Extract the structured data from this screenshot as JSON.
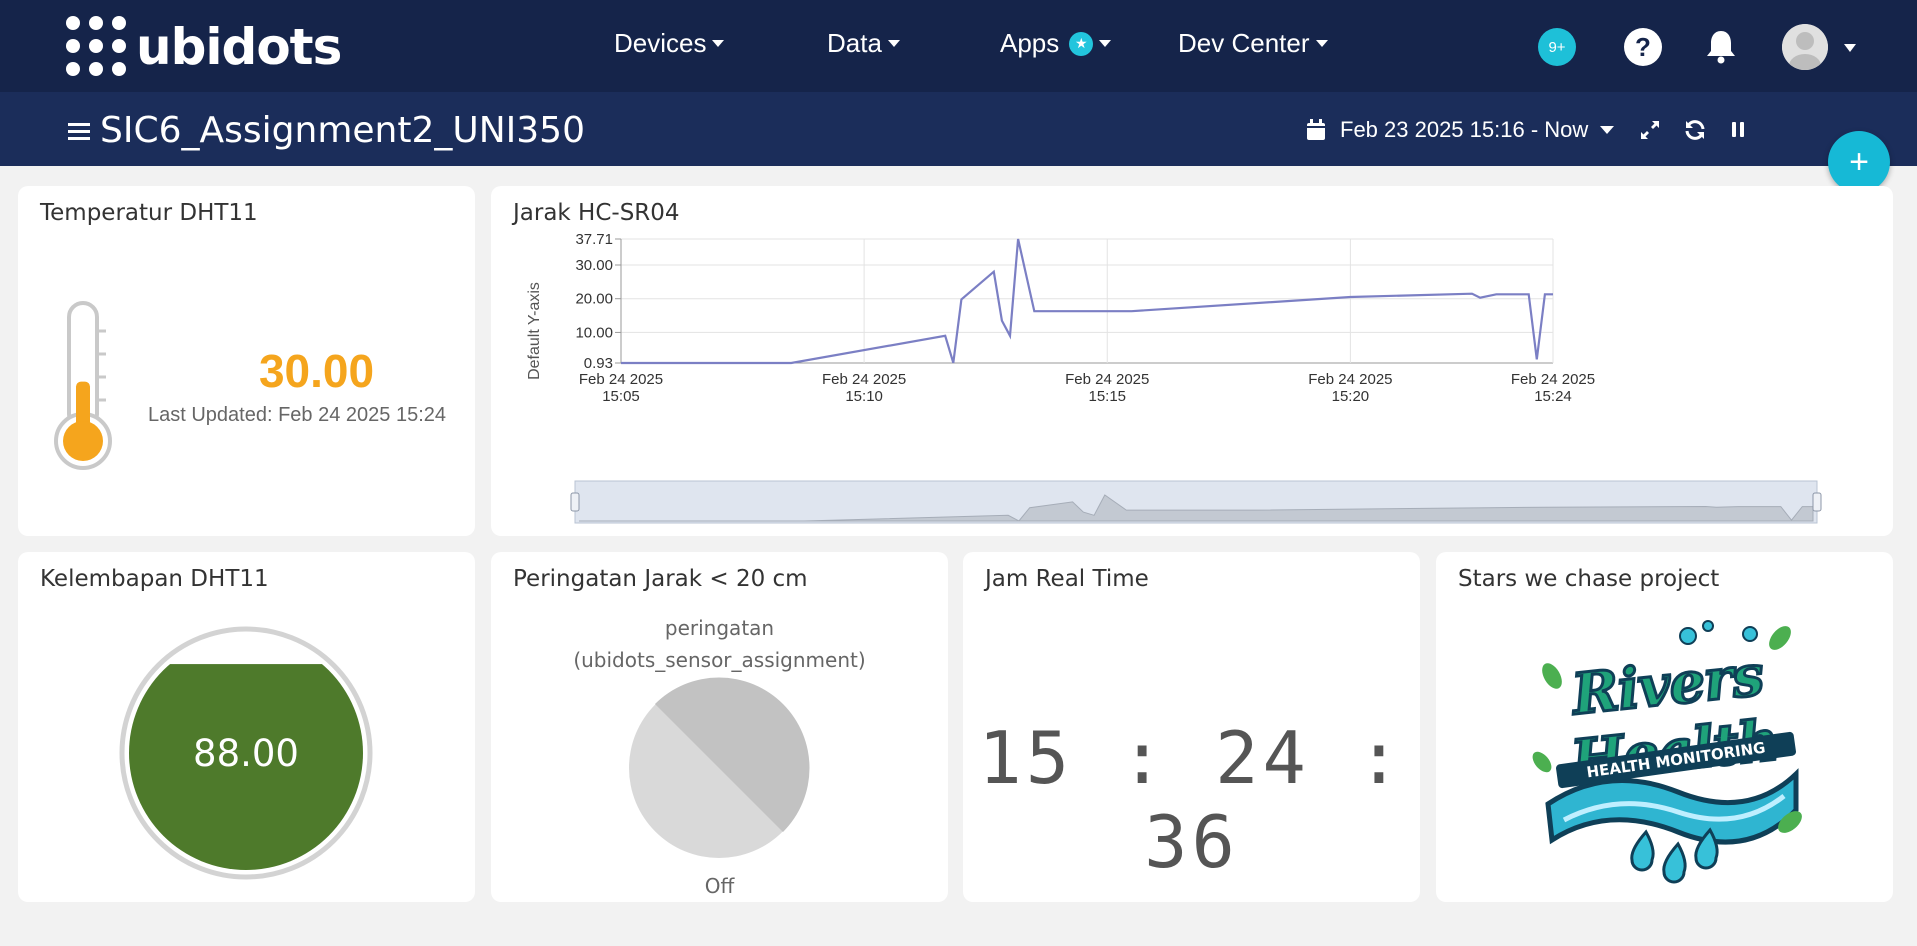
{
  "app": {
    "logo_text": "ubidots",
    "nav": {
      "devices": "Devices",
      "data": "Data",
      "apps": "Apps",
      "dev_center": "Dev Center"
    },
    "notification_badge": "9+",
    "help_label": "?",
    "accent_color": "#1ec0d8",
    "header_color": "#15244a"
  },
  "dashboard": {
    "title": "SIC6_Assignment2_UNI350",
    "date_range": "Feb 23 2025 15:16 - Now",
    "add_widget_label": "+"
  },
  "widgets": {
    "temperature": {
      "title": "Temperatur DHT11",
      "value": "30.00",
      "updated": "Last Updated: Feb 24 2025 15:24",
      "fill_level": 0.45,
      "color": "#f5a51d"
    },
    "distance_chart": {
      "title": "Jarak HC-SR04",
      "ylabel": "Default Y-axis",
      "yticks": [
        "37.71",
        "30.00",
        "20.00",
        "10.00",
        "0.93"
      ],
      "xticks": [
        {
          "d": "Feb 24 2025",
          "t": "15:05"
        },
        {
          "d": "Feb 24 2025",
          "t": "15:10"
        },
        {
          "d": "Feb 24 2025",
          "t": "15:15"
        },
        {
          "d": "Feb 24 2025",
          "t": "15:20"
        },
        {
          "d": "Feb 24 2025",
          "t": "15:24"
        }
      ],
      "line_color": "#7b7fc4"
    },
    "humidity": {
      "title": "Kelembapan DHT11",
      "value": "88.00",
      "fill_level": 0.88,
      "color": "#4e7a2b"
    },
    "warning": {
      "title": "Peringatan Jarak < 20 cm",
      "var_name": "peringatan",
      "device_name": "(ubidots_sensor_assignment)",
      "state": "Off"
    },
    "clock": {
      "title": "Jam Real Time",
      "time": "15 : 24 : 36"
    },
    "project": {
      "title": "Stars we chase project",
      "logo_text": "Rivers Health",
      "logo_subtext": "HEALTH MONITORING"
    }
  },
  "chart_data": {
    "type": "line",
    "title": "Jarak HC-SR04",
    "xlabel": "",
    "ylabel": "Default Y-axis",
    "ylim": [
      0.93,
      37.71
    ],
    "x": [
      "15:05:00",
      "15:08:30",
      "15:11:40",
      "15:11:50",
      "15:12:00",
      "15:12:40",
      "15:12:50",
      "15:13:00",
      "15:13:10",
      "15:13:30",
      "15:15:30",
      "15:20:00",
      "15:22:30",
      "15:22:40",
      "15:23:00",
      "15:23:40",
      "15:23:50",
      "15:24:00",
      "15:24:10"
    ],
    "series": [
      {
        "values": [
          0.93,
          0.93,
          9,
          1,
          19.8,
          28,
          13.5,
          9,
          37.71,
          16.3,
          16.3,
          20.5,
          21.5,
          20.3,
          21.3,
          21.3,
          2,
          21.3,
          21.3
        ]
      }
    ],
    "grid": true
  }
}
